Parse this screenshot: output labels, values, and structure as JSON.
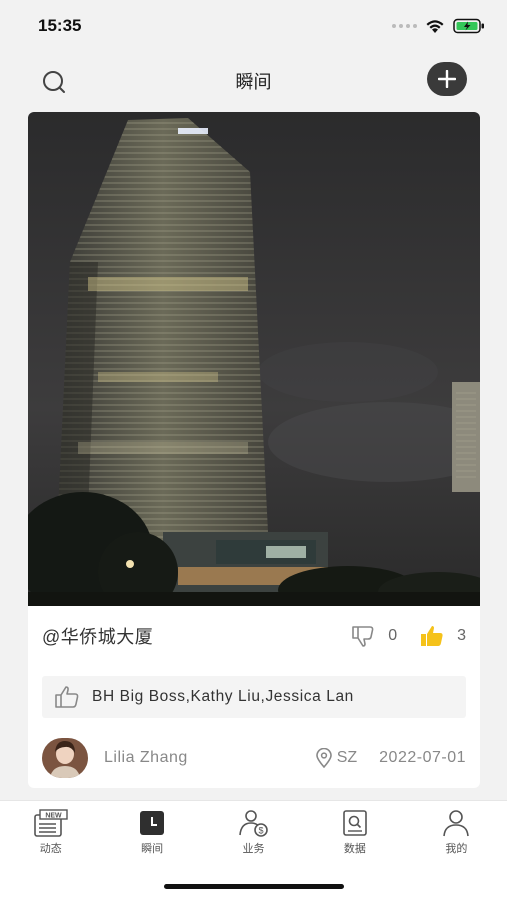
{
  "status_bar": {
    "time": "15:35"
  },
  "header": {
    "title": "瞬间"
  },
  "post": {
    "location_title": "@华侨城大厦",
    "dislike_count": "0",
    "like_count": "3",
    "liked_by": "BH Big Boss,Kathy Liu,Jessica Lan",
    "author_name": "Lilia Zhang",
    "city": "SZ",
    "date": "2022-07-01",
    "like_color": "#f5c21a"
  },
  "tabbar": {
    "items": [
      {
        "label": "动态",
        "icon": "news-icon"
      },
      {
        "label": "瞬间",
        "icon": "moment-icon"
      },
      {
        "label": "业务",
        "icon": "business-icon"
      },
      {
        "label": "数据",
        "icon": "data-icon"
      },
      {
        "label": "我的",
        "icon": "profile-icon"
      }
    ]
  }
}
